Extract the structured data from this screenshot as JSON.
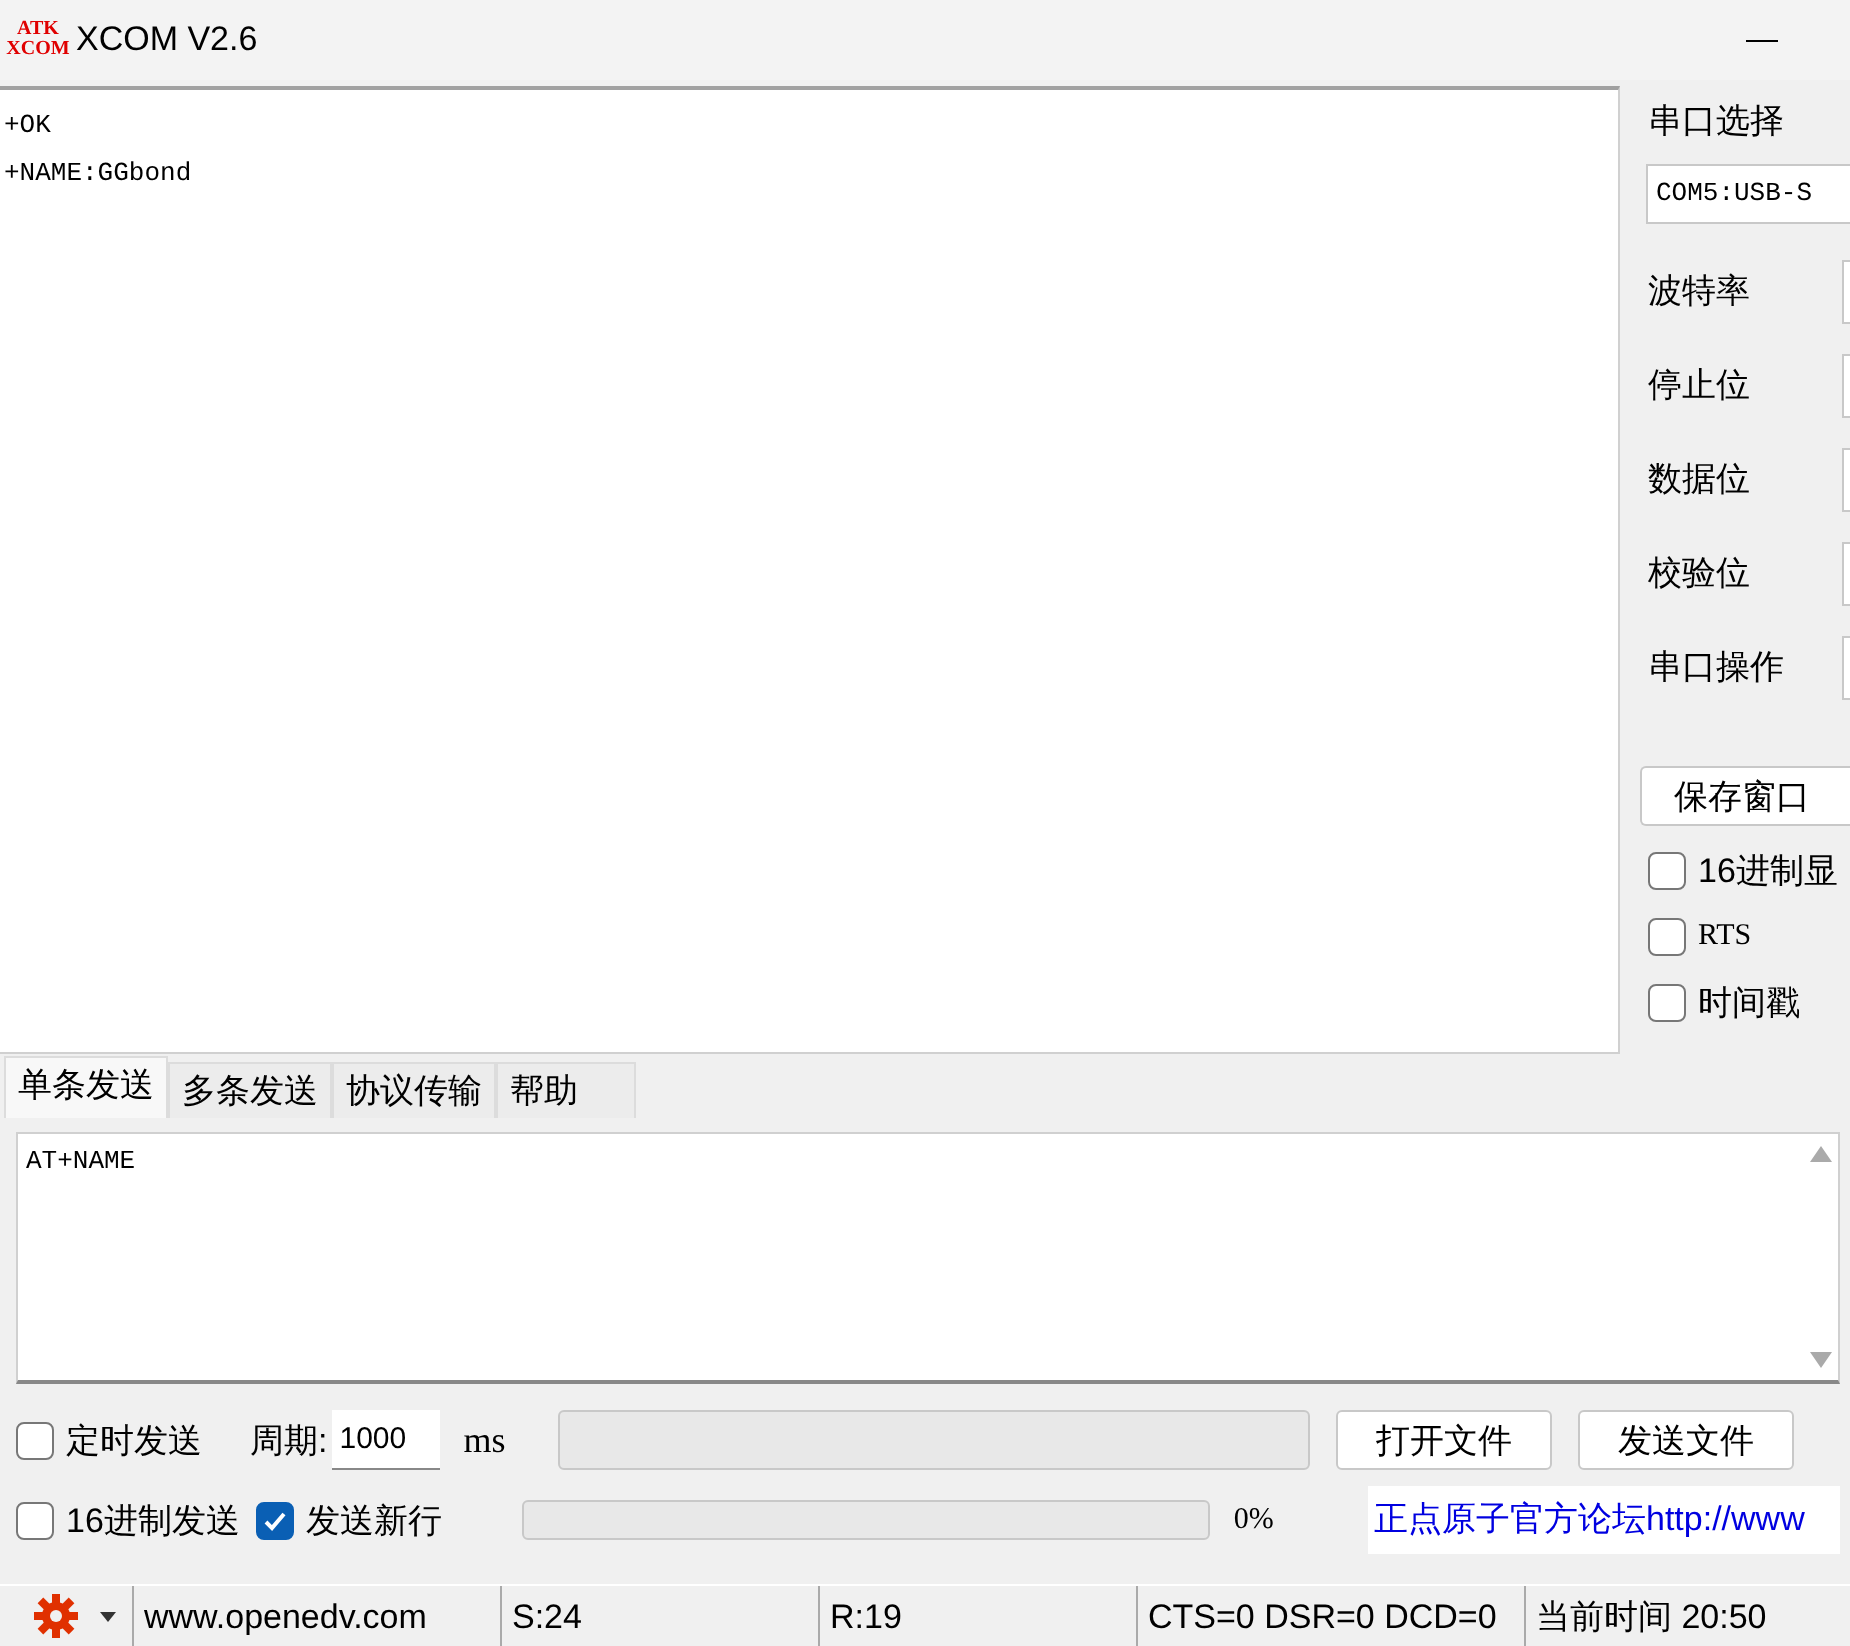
{
  "window": {
    "title": "XCOM V2.6",
    "logo": [
      "ATK",
      "XCOM"
    ]
  },
  "receive": {
    "lines": [
      "+OK",
      "+NAME:GGbond"
    ]
  },
  "serial_panel": {
    "port_label": "串口选择",
    "port_value": "COM5:USB-S",
    "settings": [
      {
        "label": "波特率"
      },
      {
        "label": "停止位"
      },
      {
        "label": "数据位"
      },
      {
        "label": "校验位"
      },
      {
        "label": "串口操作"
      }
    ],
    "save_button": "保存窗口",
    "options": [
      {
        "label": "16进制显",
        "checked": false
      },
      {
        "label": "RTS",
        "checked": false
      },
      {
        "label": "时间戳",
        "checked": false
      }
    ]
  },
  "tabs": [
    {
      "label": "单条发送",
      "selected": true
    },
    {
      "label": "多条发送",
      "selected": false
    },
    {
      "label": "协议传输",
      "selected": false
    },
    {
      "label": "帮助",
      "selected": false
    }
  ],
  "send": {
    "value": "AT+NAME"
  },
  "controls": {
    "timed_send": {
      "label": "定时发送",
      "checked": false
    },
    "period_label": "周期:",
    "period_value": "1000",
    "period_unit": "ms",
    "hex_send": {
      "label": "16进制发送",
      "checked": false
    },
    "newline": {
      "label": "发送新行",
      "checked": true
    },
    "progress": {
      "level": 0
    },
    "progress_reading": "0%",
    "open_file": "打开文件",
    "send_file": "发送文件",
    "forum_link": "正点原子官方论坛http://www"
  },
  "status_bar": {
    "website": "www.openedv.com",
    "sent": "S:24",
    "received": "R:19",
    "lines": "CTS=0 DSR=0 DCD=0",
    "time": "当前时间 20:50"
  }
}
